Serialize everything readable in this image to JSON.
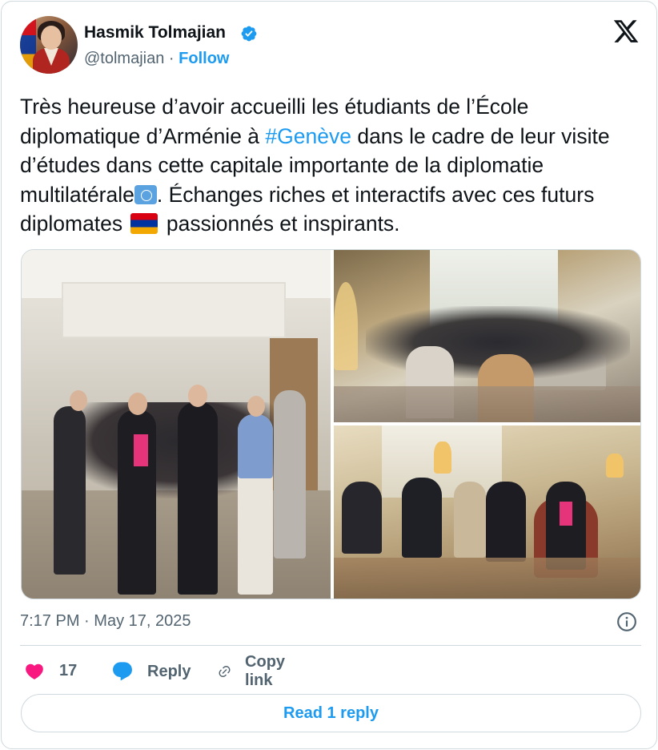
{
  "author": {
    "name": "Hasmik Tolmajian",
    "handle": "@tolmajian",
    "separator": "·",
    "follow_label": "Follow",
    "verified_color": "#1d9bf0",
    "avatar_icon": "profile-photo"
  },
  "brand": {
    "logo_icon": "x-logo"
  },
  "tweet": {
    "text_part1": "Très heureuse d’avoir accueilli les étudiants de l’École diplomatique d’Arménie à ",
    "hashtag": "#Genève",
    "text_part2": " dans le cadre de leur visite d’études dans cette capitale importante de la diplomatie multilatérale",
    "un_emoji_icon": "united-nations-flag-emoji",
    "text_part3": ".  Échanges riches et interactifs avec ces futurs diplomates ",
    "armenia_flag_icon": "armenia-flag-emoji",
    "text_part4": " passionnés et inspirants.",
    "hashtag_color": "#1d9bf0"
  },
  "media": {
    "count": 3,
    "photos": [
      {
        "name": "group-photo-staircase"
      },
      {
        "name": "meeting-room-photo"
      },
      {
        "name": "reception-room-photo"
      }
    ]
  },
  "meta": {
    "time": "7:17 PM",
    "separator": "·",
    "date": "May 17, 2025",
    "info_icon": "info-icon"
  },
  "actions": {
    "like_count": "17",
    "like_color": "#f91880",
    "reply_label": "Reply",
    "reply_color": "#1d9bf0",
    "copy_label": "Copy link"
  },
  "footer": {
    "read_replies_label": "Read 1 reply"
  }
}
